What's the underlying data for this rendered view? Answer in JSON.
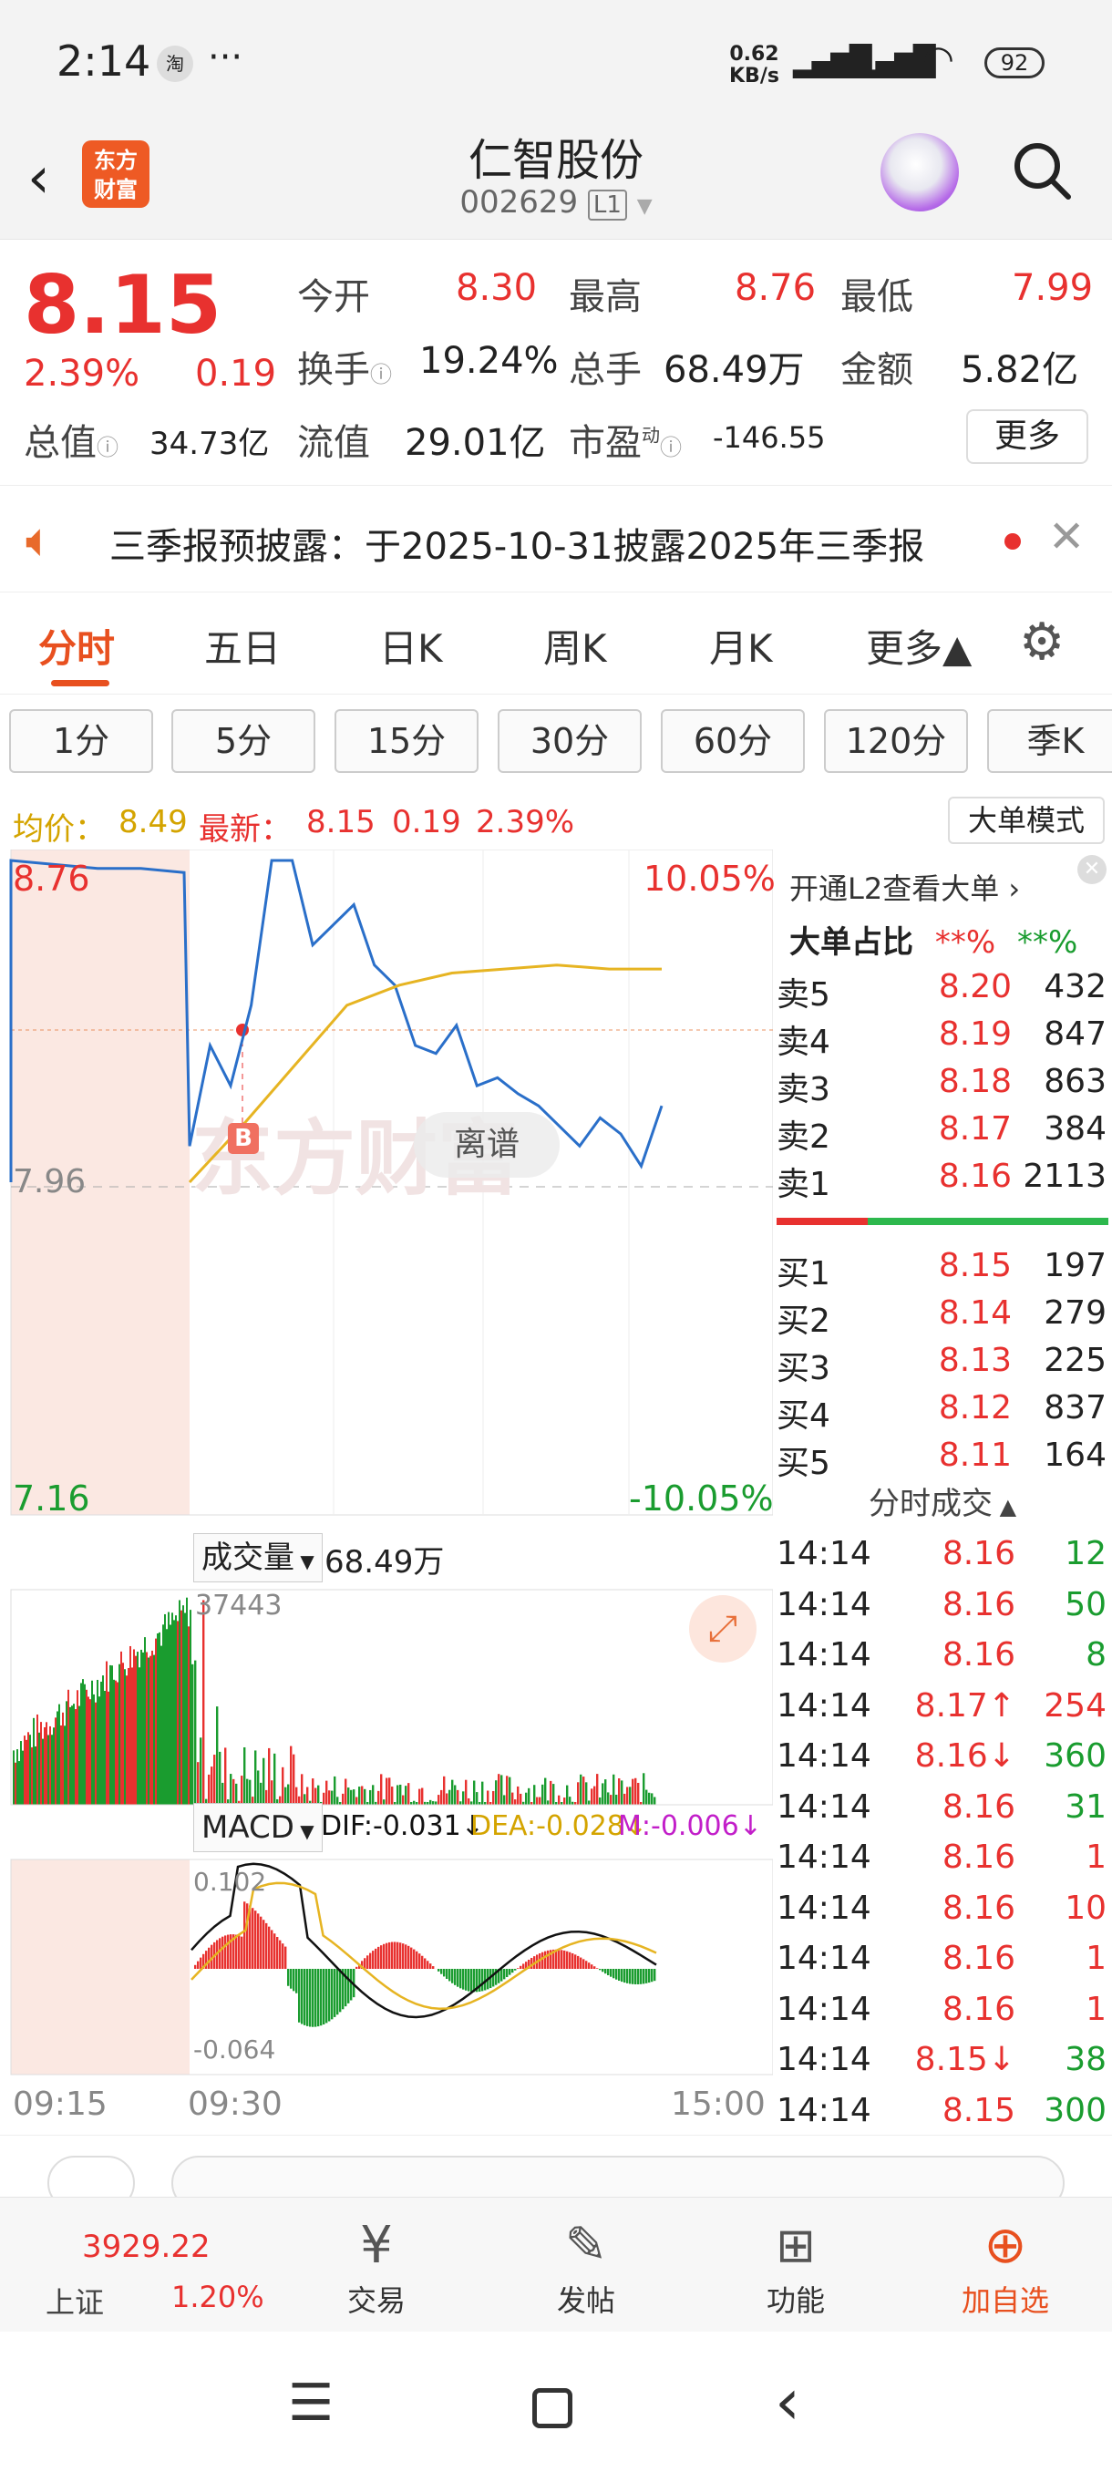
{
  "status": {
    "time": "2:14",
    "net_speed_top": "0.62",
    "net_speed_unit": "KB/s",
    "battery": "92"
  },
  "header": {
    "logo_line1": "东方",
    "logo_line2": "财富",
    "stock_name": "仁智股份",
    "stock_code": "002629",
    "level_badge": "L1"
  },
  "quote": {
    "price": "8.15",
    "change_pct": "2.39%",
    "change": "0.19",
    "open_label": "今开",
    "open": "8.30",
    "high_label": "最高",
    "high": "8.76",
    "low_label": "最低",
    "low": "7.99",
    "turnover_label": "换手",
    "turnover": "19.24%",
    "volume_label": "总手",
    "volume": "68.49万",
    "amount_label": "金额",
    "amount": "5.82亿",
    "mcap_label": "总值",
    "mcap": "34.73亿",
    "float_label": "流值",
    "float_cap": "29.01亿",
    "pe_label": "市盈",
    "pe_sup": "动",
    "pe": "-146.55",
    "more_button": "更多"
  },
  "notice": {
    "text": "三季报预披露：于2025-10-31披露2025年三季报"
  },
  "tabs": [
    {
      "label": "分时"
    },
    {
      "label": "五日"
    },
    {
      "label": "日K"
    },
    {
      "label": "周K"
    },
    {
      "label": "月K"
    },
    {
      "label": "更多▲"
    }
  ],
  "subtabs": [
    {
      "label": "1分"
    },
    {
      "label": "5分"
    },
    {
      "label": "15分"
    },
    {
      "label": "30分"
    },
    {
      "label": "60分"
    },
    {
      "label": "120分"
    },
    {
      "label": "季K"
    }
  ],
  "avgbar": {
    "avg_label": "均价：",
    "avg": "8.49",
    "latest_label": "最新：",
    "latest": "8.15",
    "change": "0.19",
    "change_pct": "2.39%",
    "mode_button": "大单模式"
  },
  "chart": {
    "price_high": "8.76",
    "price_mid": "7.96",
    "price_low": "7.16",
    "pct_high": "10.05%",
    "pct_low": "-10.05%",
    "b_marker": "B",
    "watermark": "东方财富",
    "tag": "离谱",
    "volume_label": "成交量",
    "volume_total": "68.49万",
    "volume_max": "37443",
    "macd_label": "MACD",
    "dif": "DIF:-0.031↓",
    "dea": "DEA:-0.028↓",
    "m": "M:-0.006↓",
    "macd_max": "0.102",
    "macd_min": "-0.064",
    "time_start": "09:15",
    "time_open": "09:30",
    "time_end": "15:00",
    "colors": {
      "price_line": "#2a6fc9",
      "avg_line": "#e6b422",
      "up": "#e8312f",
      "down": "#1a9c2f",
      "preopen_bg": "#fbe8e2"
    }
  },
  "chart_data": {
    "type": "line",
    "title": "",
    "x_range": [
      "09:15",
      "15:00"
    ],
    "ylim": [
      7.16,
      8.76
    ],
    "prev_close": 7.96,
    "series": [
      {
        "name": "",
        "values": [
          8.76,
          8.75,
          8.74,
          8.74,
          8.73,
          8.05,
          8.3,
          8.2,
          8.4,
          8.76,
          8.76,
          8.55,
          8.6,
          8.65,
          8.5,
          8.45,
          8.3,
          8.28,
          8.35,
          8.2,
          8.22,
          8.18,
          8.15,
          8.1,
          8.05,
          8.12,
          8.08,
          8.0,
          8.15
        ]
      },
      {
        "name": "",
        "values": [
          7.96,
          8.1,
          8.25,
          8.4,
          8.45,
          8.48,
          8.49,
          8.5,
          8.49,
          8.49
        ]
      }
    ]
  },
  "book": {
    "l2_link": "开通L2查看大单",
    "ratio_label": "大单占比",
    "ratio_red": "**%",
    "ratio_green": "**%",
    "asks": [
      {
        "label": "卖5",
        "price": "8.20",
        "vol": "432"
      },
      {
        "label": "卖4",
        "price": "8.19",
        "vol": "847"
      },
      {
        "label": "卖3",
        "price": "8.18",
        "vol": "863"
      },
      {
        "label": "卖2",
        "price": "8.17",
        "vol": "384"
      },
      {
        "label": "卖1",
        "price": "8.16",
        "vol": "2113"
      }
    ],
    "bids": [
      {
        "label": "买1",
        "price": "8.15",
        "vol": "197"
      },
      {
        "label": "买2",
        "price": "8.14",
        "vol": "279"
      },
      {
        "label": "买3",
        "price": "8.13",
        "vol": "225"
      },
      {
        "label": "买4",
        "price": "8.12",
        "vol": "837"
      },
      {
        "label": "买5",
        "price": "8.11",
        "vol": "164"
      }
    ],
    "ticks_label": "分时成交",
    "ticks": [
      {
        "t": "14:14",
        "p": "8.16",
        "v": "12",
        "c": "g"
      },
      {
        "t": "14:14",
        "p": "8.16",
        "v": "50",
        "c": "g"
      },
      {
        "t": "14:14",
        "p": "8.16",
        "v": "8",
        "c": "g"
      },
      {
        "t": "14:14",
        "p": "8.17↑",
        "v": "254",
        "c": "r"
      },
      {
        "t": "14:14",
        "p": "8.16↓",
        "v": "360",
        "c": "g"
      },
      {
        "t": "14:14",
        "p": "8.16",
        "v": "31",
        "c": "g"
      },
      {
        "t": "14:14",
        "p": "8.16",
        "v": "1",
        "c": "r"
      },
      {
        "t": "14:14",
        "p": "8.16",
        "v": "10",
        "c": "r"
      },
      {
        "t": "14:14",
        "p": "8.16",
        "v": "1",
        "c": "r"
      },
      {
        "t": "14:14",
        "p": "8.16",
        "v": "1",
        "c": "r"
      },
      {
        "t": "14:14",
        "p": "8.15↓",
        "v": "38",
        "c": "g"
      },
      {
        "t": "14:14",
        "p": "8.15",
        "v": "300",
        "c": "g"
      }
    ]
  },
  "bottomnav": {
    "index_value": "3929.22",
    "index_name": "上证",
    "index_pct": "1.20%",
    "trade": "交易",
    "post": "发帖",
    "func": "功能",
    "add": "加自选"
  }
}
